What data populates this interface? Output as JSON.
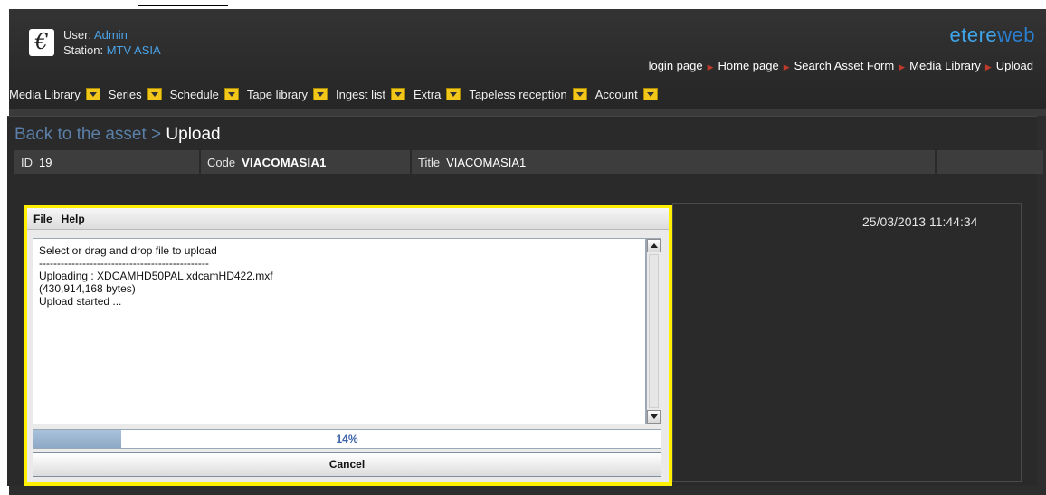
{
  "header": {
    "user_label": "User:",
    "user_value": "Admin",
    "station_label": "Station:",
    "station_value": "MTV ASIA",
    "brand_part1": "etere",
    "brand_part2": "web",
    "logo_glyph": "€"
  },
  "breadcrumb": {
    "items": [
      "login page",
      "Home page",
      "Search Asset Form",
      "Media Library",
      "Upload"
    ]
  },
  "menu": {
    "items": [
      "Media Library",
      "Series",
      "Schedule",
      "Tape library",
      "Ingest list",
      "Extra",
      "Tapeless reception",
      "Account"
    ]
  },
  "page": {
    "back_label": "Back to the asset >",
    "title": "Upload"
  },
  "fields": {
    "id_label": "ID",
    "id_value": "19",
    "code_label": "Code",
    "code_value": "VIACOMASIA1",
    "title_label": "Title",
    "title_value": "VIACOMASIA1"
  },
  "timestamp": "25/03/2013 11:44:34",
  "applet": {
    "menu_file": "File",
    "menu_help": "Help",
    "log": [
      "Select or drag and drop file to upload",
      "-----------------------------------------------",
      "Uploading : XDCAMHD50PAL.xdcamHD422.mxf",
      "(430,914,168 bytes)",
      "Upload started ..."
    ],
    "progress_percent": 14,
    "progress_label": "14%",
    "cancel_label": "Cancel"
  },
  "colors": {
    "accent_blue": "#4aa3e8",
    "highlight_border": "#ffef00",
    "dropdown": "#f2c71a"
  }
}
